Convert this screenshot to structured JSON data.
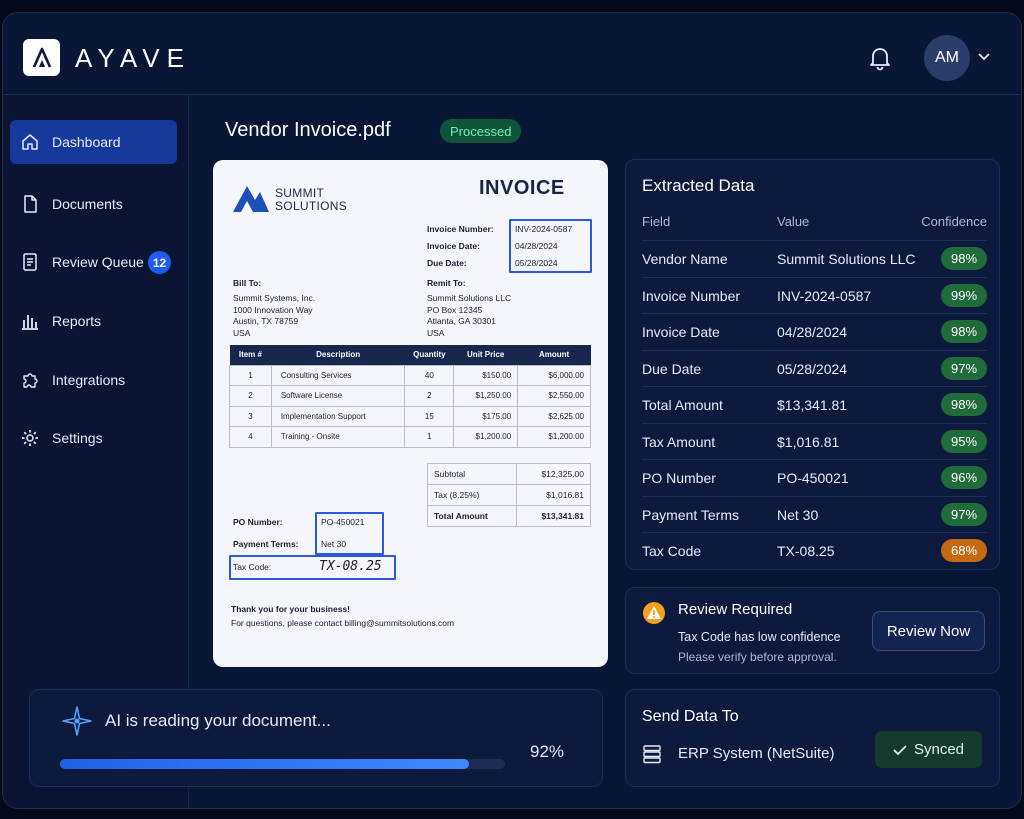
{
  "app": {
    "name": "AYAVE",
    "user_initials": "AM"
  },
  "sidebar": {
    "items": [
      {
        "label": "Dashboard",
        "icon": "home-icon",
        "active": true
      },
      {
        "label": "Documents",
        "icon": "document-icon"
      },
      {
        "label": "Review Queue",
        "icon": "review-queue-icon",
        "badge": "12"
      },
      {
        "label": "Reports",
        "icon": "bar-chart-icon"
      },
      {
        "label": "Integrations",
        "icon": "puzzle-icon"
      },
      {
        "label": "Settings",
        "icon": "gear-icon"
      }
    ]
  },
  "document": {
    "filename": "Vendor Invoice.pdf",
    "status": "Processed"
  },
  "invoice": {
    "vendor_line1": "SUMMIT",
    "vendor_line2": "SOLUTIONS",
    "heading": "INVOICE",
    "meta": {
      "number_label": "Invoice Number:",
      "number": "INV-2024-0587",
      "date_label": "Invoice Date:",
      "date": "04/28/2024",
      "due_label": "Due Date:",
      "due": "05/28/2024"
    },
    "bill_to": {
      "label": "Bill To:",
      "lines": [
        "Summit Systems, Inc.",
        "1000 Innovation Way",
        "Austin, TX 78759",
        "USA"
      ]
    },
    "remit_to": {
      "label": "Remit To:",
      "lines": [
        "Summit Solutions LLC",
        "PO Box 12345",
        "Atlanta, GA 30301",
        "USA"
      ]
    },
    "columns": [
      "Item #",
      "Description",
      "Quantity",
      "Unit Price",
      "Amount"
    ],
    "rows": [
      [
        "1",
        "Consulting Services",
        "40",
        "$150.00",
        "$6,000.00"
      ],
      [
        "2",
        "Software License",
        "2",
        "$1,250.00",
        "$2,550.00"
      ],
      [
        "3",
        "Implementation Support",
        "15",
        "$175.00",
        "$2,625.00"
      ],
      [
        "4",
        "Training - Onsite",
        "1",
        "$1,200.00",
        "$1,200.00"
      ]
    ],
    "totals": {
      "subtotal_label": "Subtotal",
      "subtotal": "$12,325.00",
      "tax_label": "Tax (8.25%)",
      "tax": "$1,016.81",
      "total_label": "Total Amount",
      "total": "$13,341.81"
    },
    "po_label": "PO Number:",
    "po": "PO-450021",
    "terms_label": "Payment Terms:",
    "terms": "Net 30",
    "tax_code_label": "Tax Code:",
    "tax_code": "TX-08.25",
    "thanks": "Thank you for your business!",
    "contact": "For questions, please contact billing@summitsolutions.com"
  },
  "extracted": {
    "title": "Extracted Data",
    "headers": {
      "field": "Field",
      "value": "Value",
      "confidence": "Confidence"
    },
    "rows": [
      {
        "field": "Vendor Name",
        "value": "Summit Solutions LLC",
        "confidence": "98%"
      },
      {
        "field": "Invoice Number",
        "value": "INV-2024-0587",
        "confidence": "99%"
      },
      {
        "field": "Invoice Date",
        "value": "04/28/2024",
        "confidence": "98%"
      },
      {
        "field": "Due Date",
        "value": "05/28/2024",
        "confidence": "97%"
      },
      {
        "field": "Total Amount",
        "value": "$13,341.81",
        "confidence": "98%"
      },
      {
        "field": "Tax Amount",
        "value": "$1,016.81",
        "confidence": "95%"
      },
      {
        "field": "PO Number",
        "value": "PO-450021",
        "confidence": "96%"
      },
      {
        "field": "Payment Terms",
        "value": "Net 30",
        "confidence": "97%"
      },
      {
        "field": "Tax Code",
        "value": "TX-08.25",
        "confidence": "68%",
        "warn": true
      }
    ]
  },
  "review": {
    "title": "Review Required",
    "message": "Tax Code has low confidence",
    "sub": "Please verify before approval.",
    "button": "Review Now"
  },
  "send": {
    "title": "Send Data To",
    "target": "ERP System (NetSuite)",
    "status": "Synced"
  },
  "ai": {
    "message": "AI is reading your document...",
    "progress_label": "92%",
    "progress": 0.92
  },
  "colors": {
    "accent": "#1d5cf0",
    "success": "#1f6b3a",
    "warning": "#c46a14",
    "background": "#0a1636"
  }
}
